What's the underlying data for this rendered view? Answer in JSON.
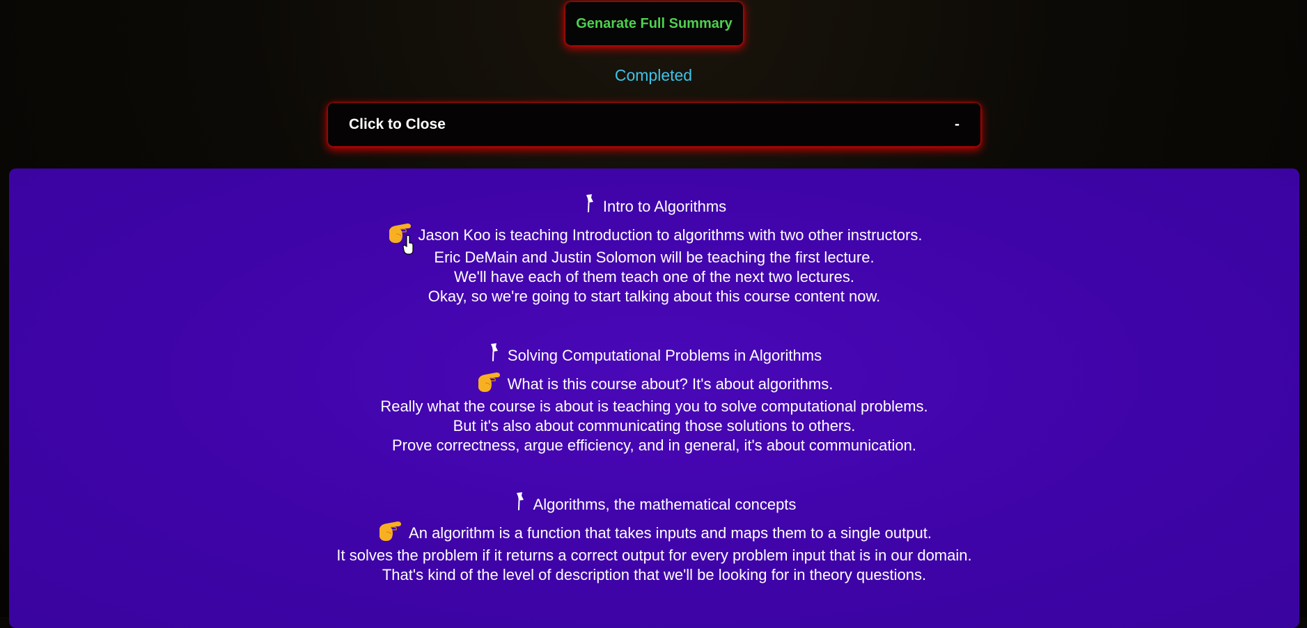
{
  "header": {
    "generate_button": "Genarate Full Summary",
    "status": "Completed",
    "collapse_label": "Click to Close",
    "collapse_toggle": "-"
  },
  "summary": {
    "sections": [
      {
        "title": "Intro to Algorithms",
        "lines": [
          "Jason Koo is teaching Introduction to algorithms with two other instructors.",
          "Eric DeMain and Justin Solomon will be teaching the first lecture.",
          "We'll have each of them teach one of the next two lectures.",
          "Okay, so we're going to start talking about this course content now."
        ]
      },
      {
        "title": "Solving Computational Problems in Algorithms",
        "lines": [
          "What is this course about? It's about algorithms.",
          "Really what the course is about is teaching you to solve computational problems.",
          "But it's also about communicating those solutions to others.",
          "Prove correctness, argue efficiency, and in general, it's about communication."
        ]
      },
      {
        "title": "Algorithms, the mathematical concepts",
        "lines": [
          "An algorithm is a function that takes inputs and maps them to a single output.",
          "It solves the problem if it returns a correct output for every problem input that is in our domain.",
          "That's kind of the level of description that we'll be looking for in theory questions."
        ]
      }
    ]
  },
  "icons": {
    "section_title_icon": "pushpin-icon",
    "paragraph_icon": "pointing-hand-icon",
    "cursor": "hand-cursor-icon"
  },
  "colors": {
    "generate_text": "#4ed14e",
    "status_text": "#3fc4e8",
    "panel_background": "#3f04a8",
    "glow": "#dc0000"
  }
}
